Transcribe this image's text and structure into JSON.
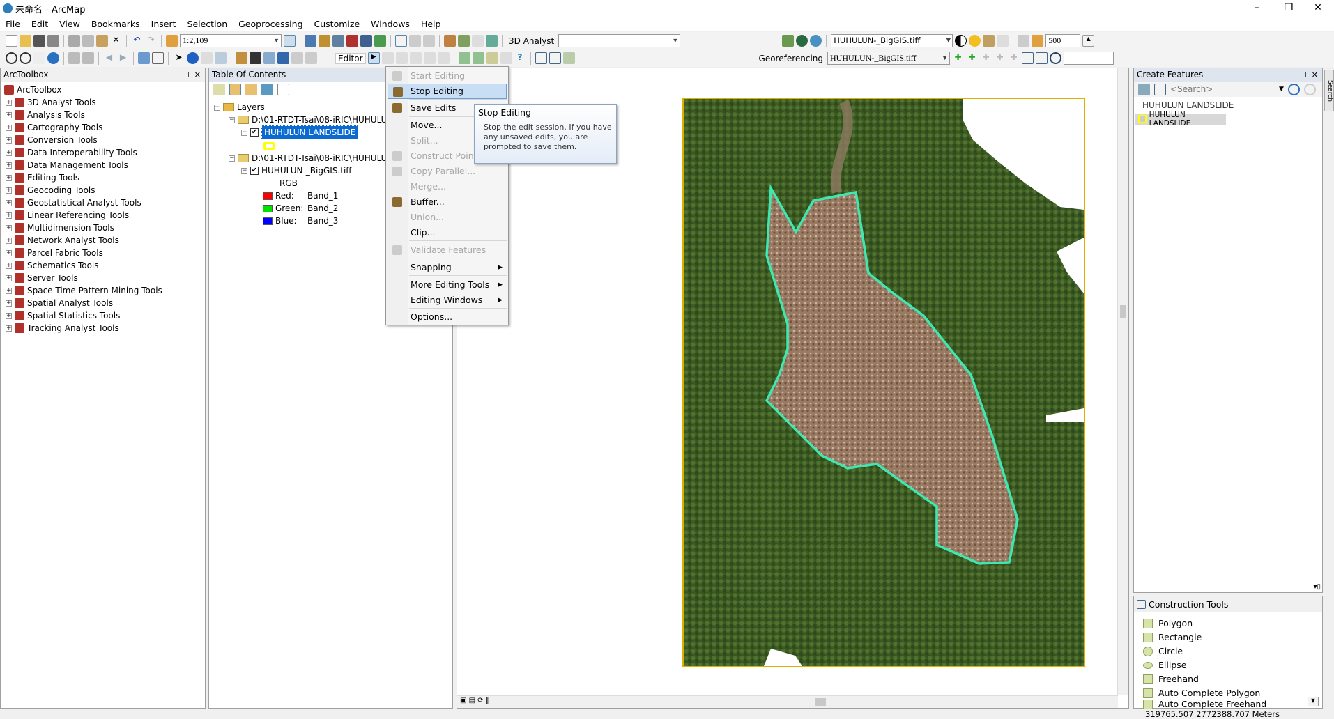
{
  "window": {
    "title": "未命名 - ArcMap",
    "controls": [
      "–",
      "❐",
      "✕"
    ]
  },
  "menubar": [
    "File",
    "Edit",
    "View",
    "Bookmarks",
    "Insert",
    "Selection",
    "Geoprocessing",
    "Customize",
    "Windows",
    "Help"
  ],
  "toolbar": {
    "scale": "1:2,109",
    "analyst_label": "3D Analyst",
    "editor_label": "Editor",
    "layer_combo": "HUHULUN-_BigGIS.tiff",
    "height_value": "500",
    "georef_label": "Georeferencing",
    "georef_layer": "HUHULUN-_BigGIS.tiff"
  },
  "arctoolbox": {
    "title": "ArcToolbox",
    "root": "ArcToolbox",
    "items": [
      "3D Analyst Tools",
      "Analysis Tools",
      "Cartography Tools",
      "Conversion Tools",
      "Data Interoperability Tools",
      "Data Management Tools",
      "Editing Tools",
      "Geocoding Tools",
      "Geostatistical Analyst Tools",
      "Linear Referencing Tools",
      "Multidimension Tools",
      "Network Analyst Tools",
      "Parcel Fabric Tools",
      "Schematics Tools",
      "Server Tools",
      "Space Time Pattern Mining Tools",
      "Spatial Analyst Tools",
      "Spatial Statistics Tools",
      "Tracking Analyst Tools"
    ]
  },
  "toc": {
    "title": "Table Of Contents",
    "root": "Layers",
    "folder1": "D:\\01-RTDT-Tsai\\08-iRIC\\HUHULUN",
    "layer1": "HUHULUN LANDSLIDE",
    "folder2": "D:\\01-RTDT-Tsai\\08-iRIC\\HUHULUN",
    "layer2": "HUHULUN-_BigGIS.tiff",
    "rgb": "RGB",
    "bands": [
      {
        "label": "Red:",
        "band": "Band_1",
        "color": "#ff0000"
      },
      {
        "label": "Green:",
        "band": "Band_2",
        "color": "#00e000"
      },
      {
        "label": "Blue:",
        "band": "Band_3",
        "color": "#0000ff"
      }
    ]
  },
  "editor_menu": {
    "items": [
      {
        "label": "Start Editing",
        "disabled": true
      },
      {
        "label": "Stop Editing",
        "highlighted": true
      },
      {
        "label": "Save Edits"
      },
      {
        "label": "Move..."
      },
      {
        "label": "Split...",
        "disabled": true
      },
      {
        "label": "Construct Points...",
        "disabled": true
      },
      {
        "label": "Copy Parallel...",
        "disabled": true
      },
      {
        "label": "Merge...",
        "disabled": true
      },
      {
        "label": "Buffer..."
      },
      {
        "label": "Union...",
        "disabled": true
      },
      {
        "label": "Clip..."
      },
      {
        "label": "Validate Features",
        "disabled": true
      },
      {
        "label": "Snapping",
        "submenu": true
      },
      {
        "label": "More Editing Tools",
        "submenu": true
      },
      {
        "label": "Editing Windows",
        "submenu": true
      },
      {
        "label": "Options..."
      }
    ]
  },
  "tooltip": {
    "title": "Stop Editing",
    "body": "Stop the edit session. If you have any unsaved edits, you are prompted to save them."
  },
  "create_features": {
    "title": "Create Features",
    "search_placeholder": "<Search>",
    "group": "HUHULUN LANDSLIDE",
    "template": "HUHULUN LANDSLIDE",
    "side_tab": "Search"
  },
  "construction_tools": {
    "title": "Construction Tools",
    "items": [
      "Polygon",
      "Rectangle",
      "Circle",
      "Ellipse",
      "Freehand",
      "Auto Complete Polygon",
      "Auto Complete Freehand"
    ]
  },
  "status": {
    "coords": "319765.507  2772388.707 Meters"
  },
  "colors": {
    "polygon_outline": "#3ee8b0",
    "selection": "#0a6ad0",
    "symbol_fill": "#ffff00",
    "frame": "#e0b000"
  }
}
